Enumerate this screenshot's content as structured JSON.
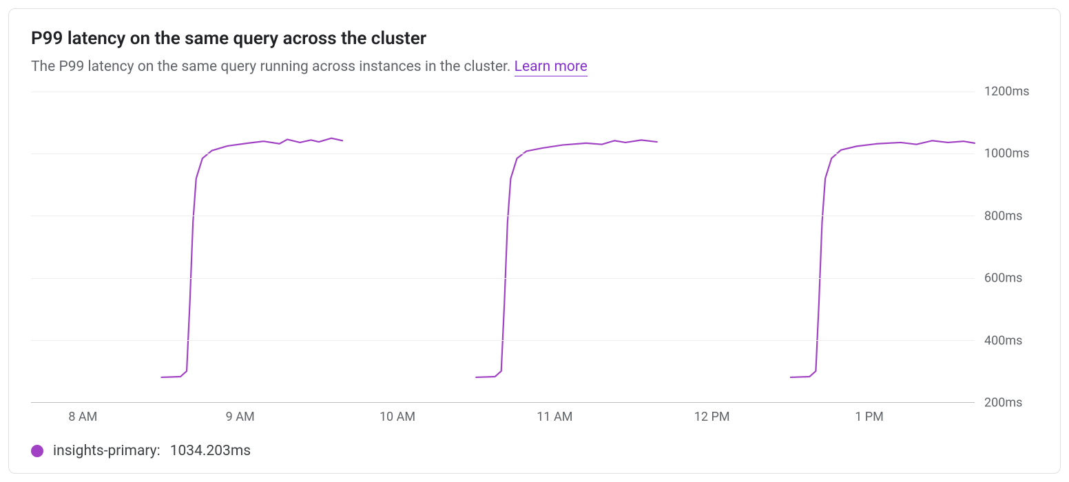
{
  "title": "P99 latency on the same query across the cluster",
  "subtitle": "The P99 latency on the same query running across instances in the cluster. ",
  "learn_more": "Learn more",
  "legend": {
    "series_name": "insights-primary:",
    "series_value": "1034.203ms"
  },
  "colors": {
    "series": "#a142c4"
  },
  "chart_data": {
    "type": "line",
    "title": "P99 latency on the same query across the cluster",
    "xlabel": "",
    "ylabel": "",
    "ylim": [
      200,
      1200
    ],
    "xlim": [
      7.67,
      13.67
    ],
    "x_ticks": [
      {
        "value": 8,
        "label": "8 AM"
      },
      {
        "value": 9,
        "label": "9 AM"
      },
      {
        "value": 10,
        "label": "10 AM"
      },
      {
        "value": 11,
        "label": "11 AM"
      },
      {
        "value": 12,
        "label": "12 PM"
      },
      {
        "value": 13,
        "label": "1 PM"
      }
    ],
    "y_ticks": [
      {
        "value": 200,
        "label": "200ms"
      },
      {
        "value": 400,
        "label": "400ms"
      },
      {
        "value": 600,
        "label": "600ms"
      },
      {
        "value": 800,
        "label": "800ms"
      },
      {
        "value": 1000,
        "label": "1000ms"
      },
      {
        "value": 1200,
        "label": "1200ms"
      }
    ],
    "series": [
      {
        "name": "insights-primary",
        "color": "#a142c4",
        "segments": [
          {
            "points": [
              {
                "x": 8.5,
                "y": 280
              },
              {
                "x": 8.62,
                "y": 282
              },
              {
                "x": 8.66,
                "y": 300
              },
              {
                "x": 8.68,
                "y": 520
              },
              {
                "x": 8.7,
                "y": 780
              },
              {
                "x": 8.72,
                "y": 920
              },
              {
                "x": 8.76,
                "y": 985
              },
              {
                "x": 8.82,
                "y": 1010
              },
              {
                "x": 8.92,
                "y": 1025
              },
              {
                "x": 9.05,
                "y": 1034
              },
              {
                "x": 9.15,
                "y": 1040
              },
              {
                "x": 9.25,
                "y": 1032
              },
              {
                "x": 9.3,
                "y": 1046
              },
              {
                "x": 9.38,
                "y": 1036
              },
              {
                "x": 9.45,
                "y": 1044
              },
              {
                "x": 9.5,
                "y": 1038
              },
              {
                "x": 9.58,
                "y": 1050
              },
              {
                "x": 9.65,
                "y": 1042
              }
            ]
          },
          {
            "points": [
              {
                "x": 10.5,
                "y": 280
              },
              {
                "x": 10.62,
                "y": 282
              },
              {
                "x": 10.66,
                "y": 300
              },
              {
                "x": 10.68,
                "y": 520
              },
              {
                "x": 10.7,
                "y": 780
              },
              {
                "x": 10.72,
                "y": 920
              },
              {
                "x": 10.76,
                "y": 985
              },
              {
                "x": 10.82,
                "y": 1008
              },
              {
                "x": 10.92,
                "y": 1018
              },
              {
                "x": 11.05,
                "y": 1028
              },
              {
                "x": 11.2,
                "y": 1034
              },
              {
                "x": 11.3,
                "y": 1030
              },
              {
                "x": 11.38,
                "y": 1042
              },
              {
                "x": 11.45,
                "y": 1036
              },
              {
                "x": 11.55,
                "y": 1044
              },
              {
                "x": 11.65,
                "y": 1038
              }
            ]
          },
          {
            "points": [
              {
                "x": 12.5,
                "y": 280
              },
              {
                "x": 12.62,
                "y": 282
              },
              {
                "x": 12.66,
                "y": 300
              },
              {
                "x": 12.68,
                "y": 520
              },
              {
                "x": 12.7,
                "y": 780
              },
              {
                "x": 12.72,
                "y": 920
              },
              {
                "x": 12.76,
                "y": 985
              },
              {
                "x": 12.82,
                "y": 1012
              },
              {
                "x": 12.92,
                "y": 1024
              },
              {
                "x": 13.05,
                "y": 1032
              },
              {
                "x": 13.2,
                "y": 1036
              },
              {
                "x": 13.3,
                "y": 1030
              },
              {
                "x": 13.4,
                "y": 1042
              },
              {
                "x": 13.5,
                "y": 1036
              },
              {
                "x": 13.6,
                "y": 1040
              },
              {
                "x": 13.67,
                "y": 1034
              }
            ]
          }
        ]
      }
    ]
  }
}
